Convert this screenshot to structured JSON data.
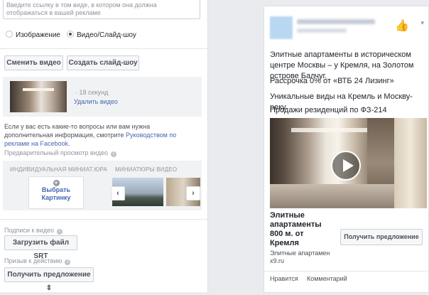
{
  "editor": {
    "url_hint": "Введите ссылку в том виде, в котором она должна отображаться в вашей рекламе",
    "media_options": {
      "image": "Изображение",
      "video": "Видео/Слайд-шоу",
      "selected": "video"
    },
    "change_video_btn": "Сменить видео",
    "create_slideshow_btn": "Создать слайд-шоу",
    "video_duration": "· 18 секунд",
    "delete_video_link": "Удалить видео",
    "help_text": "Если у вас есть какие-то вопросы или вам нужна дополнительная информация, смотрите ",
    "help_link": "Руководством по рекламе на Facebook",
    "help_end": ".",
    "preview_label": "Предварительный просмотр видео",
    "single_thumb_header": "ИНДИВИДУАЛЬНАЯ МИНИАТ.ЮРА",
    "thumbs_header": "МИНИАТЮРЫ ВИДЕО",
    "choose_thumb_line1": "Выбрать",
    "choose_thumb_line2": "Картинку",
    "captions_label": "Подписи к видео",
    "upload_srt_btn": "Загрузить файл SRT",
    "cta_label": "Призыв к действию",
    "cta_select": "Получить предложение ⇕"
  },
  "ad_preview": {
    "line1": "Элитные апартаменты в историческом центре Москвы – у Кремля, на Золотом острове Балчуг.",
    "line2": "Рассрочка 0% от «ВТБ 24 Лизинг»",
    "line3": "Уникальные виды на Кремль и Москву-реку",
    "line4": "Продажи резиденций по ФЗ-214",
    "title": "Элитные апартаменты 800 м. от Кремля",
    "description": "Элитные апартамен",
    "domain": "x9.ru",
    "cta_button": "Получить предложение",
    "like_action": "Нравится",
    "comment_action": "Комментарий"
  },
  "icons": {
    "info": "info-icon",
    "plus": "plus-icon",
    "play": "play-icon",
    "thumb_up": "thumbs-up-icon",
    "chevron": "chevron-down-icon"
  },
  "colors": {
    "link": "#4267b2",
    "muted": "#90949c",
    "panel_bg": "#f1f2f4"
  }
}
